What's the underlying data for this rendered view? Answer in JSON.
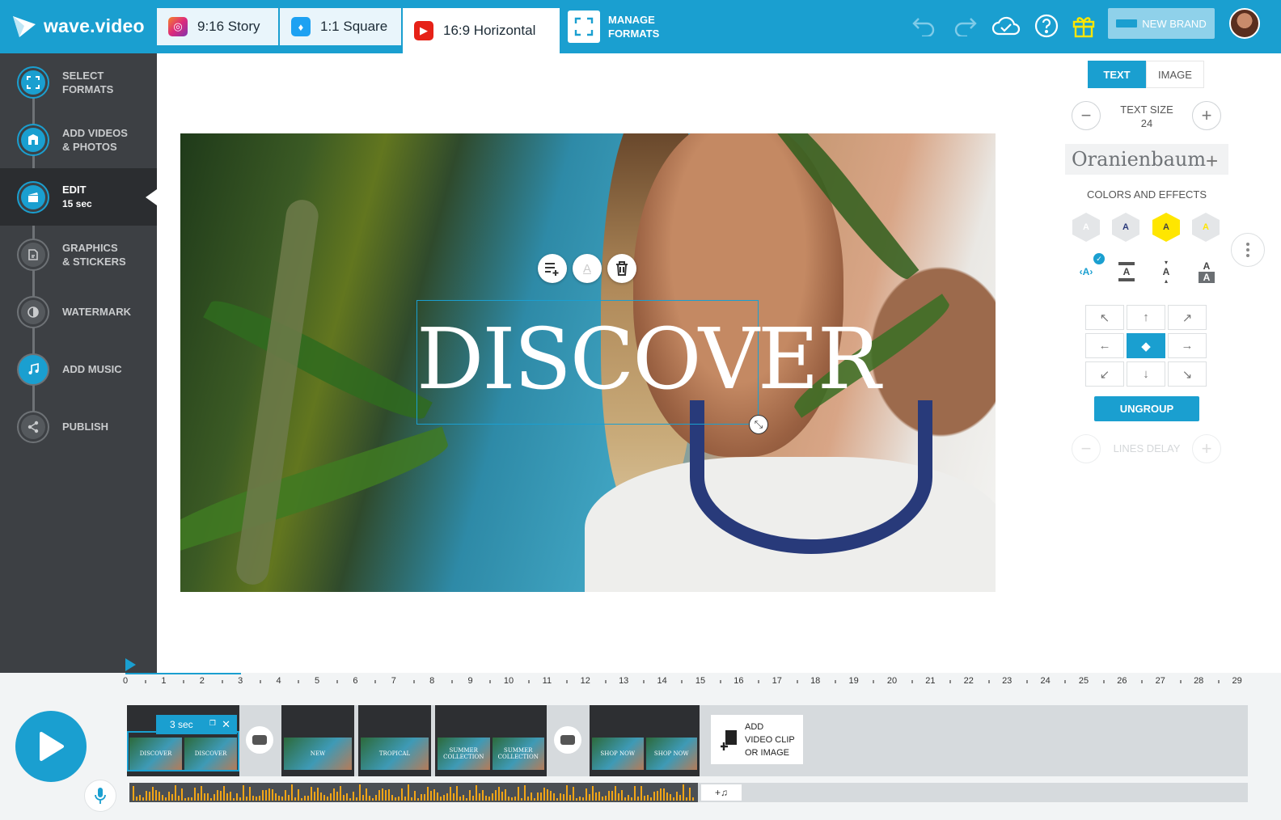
{
  "app": {
    "logo_text": "wave.video"
  },
  "formats": [
    {
      "label": "9:16 Story",
      "icon": "instagram-icon"
    },
    {
      "label": "1:1 Square",
      "icon": "twitter-icon"
    },
    {
      "label": "16:9 Horizontal",
      "icon": "youtube-icon"
    }
  ],
  "manage_formats": {
    "line1": "MANAGE",
    "line2": "FORMATS"
  },
  "toolbar": {
    "brand_label": "NEW BRAND"
  },
  "sidebar": {
    "items": [
      {
        "line1": "SELECT",
        "line2": "FORMATS",
        "icon": "formats-icon"
      },
      {
        "line1": "ADD VIDEOS",
        "line2": "& PHOTOS",
        "icon": "media-icon"
      },
      {
        "line1": "EDIT",
        "line2": "15 sec",
        "icon": "clapper-icon"
      },
      {
        "line1": "GRAPHICS",
        "line2": "& STICKERS",
        "icon": "sticker-icon"
      },
      {
        "line1": "WATERMARK",
        "line2": "",
        "icon": "watermark-icon"
      },
      {
        "line1": "ADD MUSIC",
        "line2": "",
        "icon": "music-icon"
      },
      {
        "line1": "PUBLISH",
        "line2": "",
        "icon": "share-icon"
      }
    ]
  },
  "canvas": {
    "text": "DISCOVER"
  },
  "panel": {
    "tab_text": "TEXT",
    "tab_image": "IMAGE",
    "text_size_label": "TEXT SIZE",
    "text_size_value": "24",
    "font_name": "Oranienbaum",
    "colors_label": "COLORS AND EFFECTS",
    "ungroup_label": "UNGROUP",
    "lines_delay_label": "LINES DELAY",
    "style_glyph": "A"
  },
  "timeline": {
    "ticks": [
      "0",
      "1",
      "2",
      "3",
      "4",
      "5",
      "6",
      "7",
      "8",
      "9",
      "10",
      "11",
      "12",
      "13",
      "14",
      "15",
      "16",
      "17",
      "18",
      "19",
      "20",
      "21",
      "22",
      "23",
      "24",
      "25",
      "26",
      "27",
      "28",
      "29"
    ],
    "clip_duration": "3 sec",
    "clips": [
      {
        "thumbs": [
          "DISCOVER",
          "DISCOVER"
        ]
      },
      {
        "thumbs": [
          "NEW"
        ]
      },
      {
        "thumbs": [
          "TROPICAL"
        ]
      },
      {
        "thumbs": [
          "SUMMER COLLECTION",
          "SUMMER COLLECTION"
        ]
      },
      {
        "thumbs": [
          "SHOP NOW",
          "SHOP NOW"
        ]
      }
    ],
    "add_clip": {
      "line1": "ADD",
      "line2": "VIDEO CLIP",
      "line3": "OR IMAGE"
    }
  },
  "colors": {
    "accent": "#1a9fd0",
    "sidebar": "#3d4044",
    "highlight_yellow": "#ffe600"
  }
}
